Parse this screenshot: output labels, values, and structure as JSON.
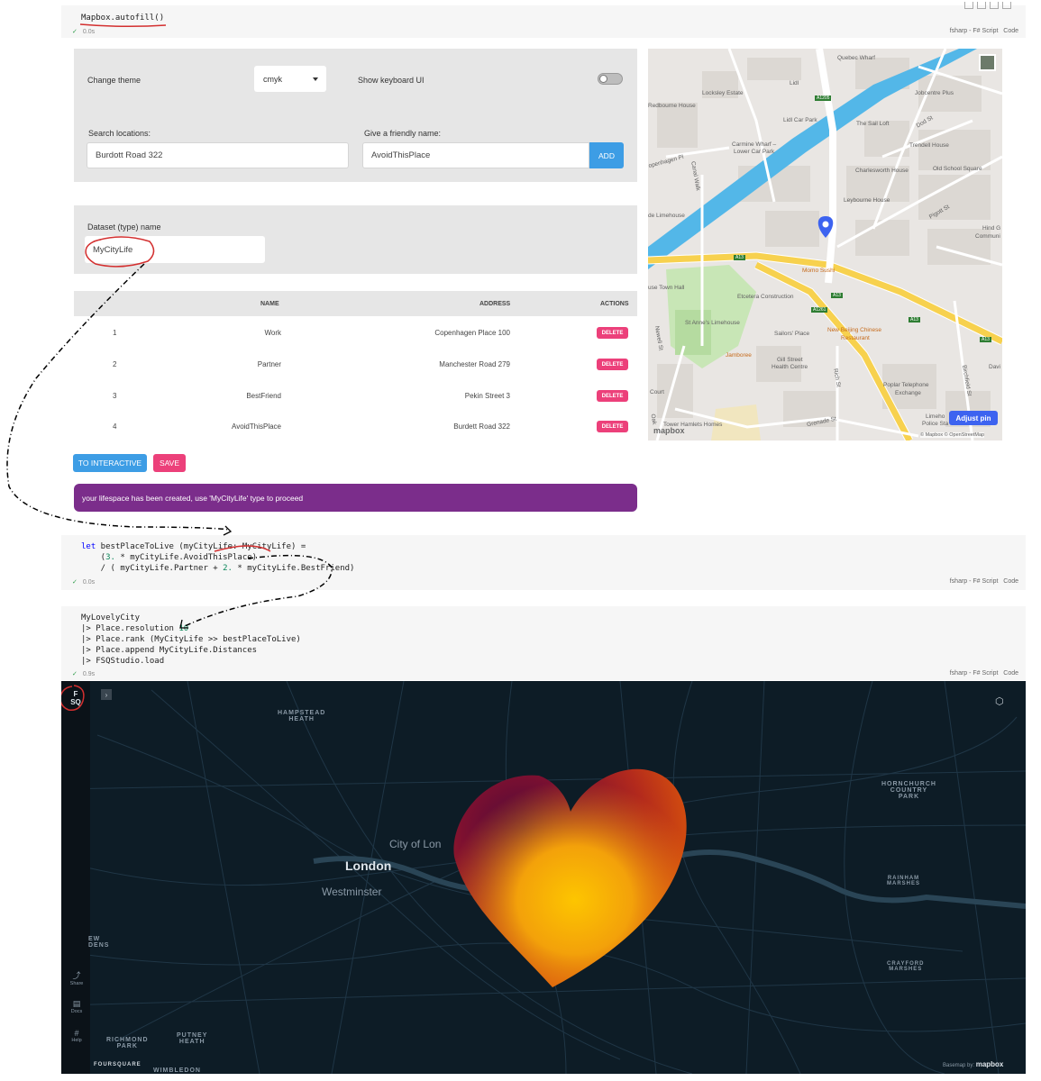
{
  "cells": [
    {
      "code": "Mapbox.autofill()",
      "time": "0.0s",
      "lang": "fsharp - F# Script",
      "lang_action": "Code"
    },
    {
      "line1_kw": "let",
      "line1_rest": " bestPlaceToLive (myCityLife: MyCityLife) =",
      "line2_num": "3.",
      "line2_rest": " * myCityLife.AvoidThisPlace)",
      "line2_pre": "    (",
      "line3_pre": "    / ( myCityLife.Partner + ",
      "line3_num": "2.",
      "line3_rest": " * myCityLife.BestFriend)",
      "time": "0.0s",
      "lang": "fsharp - F# Script",
      "lang_action": "Code"
    },
    {
      "line1": "MyLovelyCity",
      "line2_pre": "|> Place.resolution ",
      "line2_num": "10",
      "line3": "|> Place.rank (MyCityLife >> bestPlaceToLive)",
      "line4": "|> Place.append MyCityLife.Distances",
      "line5": "|> FSQStudio.load",
      "time": "0.9s",
      "lang": "fsharp - F# Script",
      "lang_action": "Code"
    }
  ],
  "widget": {
    "theme_label": "Change theme",
    "theme_value": "cmyk",
    "keyboard_label": "Show keyboard UI",
    "search_label": "Search locations:",
    "search_value": "Burdott Road 322",
    "friendly_label": "Give a friendly name:",
    "friendly_value": "AvoidThisPlace",
    "add_button": "ADD",
    "dataset_label": "Dataset (type) name",
    "dataset_value": "MyCityLife",
    "table": {
      "headers": [
        "NAME",
        "ADDRESS",
        "ACTIONS"
      ],
      "rows": [
        {
          "id": "1",
          "name": "Work",
          "address": "Copenhagen Place 100",
          "action": "DELETE"
        },
        {
          "id": "2",
          "name": "Partner",
          "address": "Manchester Road 279",
          "action": "DELETE"
        },
        {
          "id": "3",
          "name": "BestFriend",
          "address": "Pekin Street 3",
          "action": "DELETE"
        },
        {
          "id": "4",
          "name": "AvoidThisPlace",
          "address": "Burdett Road 322",
          "action": "DELETE"
        }
      ]
    },
    "interactive_button": "TO INTERACTIVE",
    "save_button": "SAVE",
    "message": "your lifespace has been created, use 'MyCityLife' type to proceed",
    "colors": {
      "accent": "#3d9de5",
      "pink": "#ec407a",
      "purple": "#7b2d8b"
    }
  },
  "light_map": {
    "labels": {
      "quebec": "Quebec Wharf",
      "lidl": "Lidl",
      "locksley": "Locksley Estate",
      "a1205": "A1205",
      "jobcentre": "Jobcentre Plus",
      "redbourne": "Redbourne House",
      "lidlpark": "Lidl Car Park",
      "sailloft": "The Sail Loft",
      "dod": "Dod St",
      "carmine": "Carmine Wharf –",
      "carmine2": "Lower Car Park",
      "trendell": "Trendell House",
      "copenhagen": "openhagen Pl",
      "charlesworth": "Charlesworth House",
      "oldschool": "Old School Square",
      "canal": "Canal Walk",
      "leybourne": "Leybourne House",
      "limehouse": "de Limehouse",
      "pigott": "Pigott St",
      "hind": "Hind G",
      "commun": "Communi",
      "a13a": "A13",
      "momo": "Momo Sushi",
      "townhall": "use Town Hall",
      "etcetera": "Etcetera Construction",
      "a13b": "A13",
      "a1261": "A1261",
      "a13c": "A13",
      "a13d": "A13",
      "stanne": "St Anne's Limehouse",
      "sailors": "Sailors' Place",
      "newbeijing": "New Beijing Chinese",
      "restaurant": "Restaurant",
      "newell": "Newell St",
      "jamboree": "Jamboree",
      "gill": "Gill Street",
      "gill2": "Health Centre",
      "birchfield": "Birchfield St",
      "davi": "Davi",
      "poplar": "Poplar Telephone",
      "exchange": "Exchange",
      "court": "Court",
      "rich": "Rich St",
      "limehou": "Limeho",
      "police": "Police Sta",
      "oak": "Oak",
      "towerhamlets": "Tower Hamlets Homes",
      "grenade": "Grenade St",
      "adjust_pin": "Adjust pin",
      "attribution": "© Mapbox © OpenStreetMap",
      "logo": "mapbox"
    }
  },
  "dark_map": {
    "logo_line1": "F",
    "logo_line2": "SQ",
    "labels": {
      "hampstead": "HAMPSTEAD\nHEATH",
      "hornchurch": "HORNCHURCH\nCOUNTRY\nPARK",
      "rainham": "RAINHAM\nMARSHES",
      "crayford": "CRAYFORD\nMARSHES",
      "richmond": "RICHMOND\nPARK",
      "putney": "PUTNEY\nHEATH",
      "ew": "EW\nDENS",
      "wimbledon": "WIMBLEDON",
      "city": "City of Lon",
      "london": "London",
      "westminster": "Westminster"
    },
    "sidebar": {
      "share": "Share",
      "docs": "Docs",
      "help": "Help"
    },
    "foursquare": "FOURSQUARE",
    "basemap_by": "Basemap by:",
    "basemap_logo": "mapbox"
  }
}
